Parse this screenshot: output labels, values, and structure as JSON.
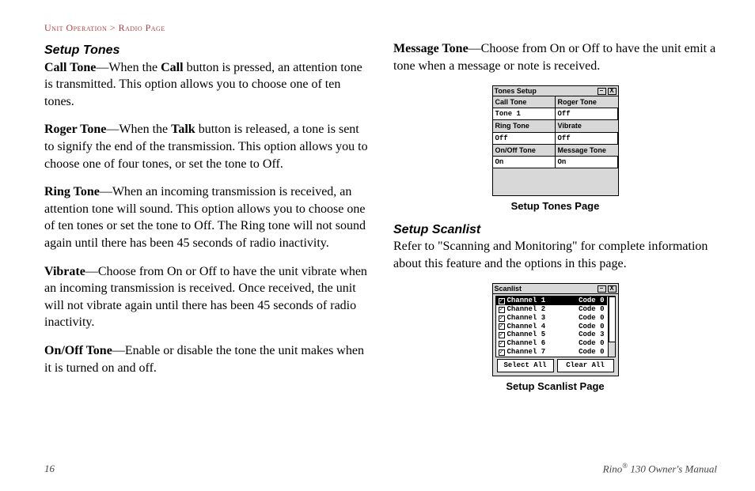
{
  "breadcrumb": "Unit Operation > Radio Page",
  "left": {
    "h1": "Setup Tones",
    "p1_b1": "Call Tone",
    "p1_mid": "—When the ",
    "p1_b2": "Call",
    "p1_rest": " button is pressed, an attention tone is transmitted. This option allows you to choose one of ten tones.",
    "p2_b1": "Roger Tone",
    "p2_mid": "—When the ",
    "p2_b2": "Talk",
    "p2_rest": " button is released, a tone is sent to signify the end of the transmission. This option allows you to choose one of four tones, or set the tone to Off.",
    "p3_b1": "Ring Tone",
    "p3_rest": "—When an incoming transmission is received, an attention tone will sound. This option allows you to choose one of ten tones or set the tone to Off. The Ring tone will not sound again until there has been 45 seconds of radio inactivity.",
    "p4_b1": "Vibrate",
    "p4_rest": "—Choose from On or Off to have the unit vibrate when an incoming transmission is received. Once received, the unit will not vibrate again until there has been 45 seconds of radio inactivity.",
    "p5_b1": "On/Off Tone",
    "p5_rest": "—Enable or disable the tone the unit makes when it is turned on and off."
  },
  "right": {
    "p1_b1": "Message Tone",
    "p1_rest": "—Choose from On or Off to have the unit emit a tone when a message or note is received.",
    "tones_caption": "Setup Tones Page",
    "h2": "Setup Scanlist",
    "p2": "Refer to \"Scanning and Monitoring\" for complete information about this feature and the options in this page.",
    "scan_caption": "Setup Scanlist Page"
  },
  "tones_fig": {
    "title": "Tones Setup",
    "rows": [
      {
        "l_label": "Call Tone",
        "r_label": "Roger Tone",
        "l_val": "Tone 1",
        "r_val": "Off"
      },
      {
        "l_label": "Ring Tone",
        "r_label": "Vibrate",
        "l_val": "Off",
        "r_val": "Off"
      },
      {
        "l_label": "On/Off Tone",
        "r_label": "Message Tone",
        "l_val": "On",
        "r_val": "On"
      }
    ]
  },
  "scan_fig": {
    "title": "Scanlist",
    "items": [
      {
        "label": "Channel 1",
        "code": "Code 0",
        "sel": true
      },
      {
        "label": "Channel 2",
        "code": "Code 0",
        "sel": false
      },
      {
        "label": "Channel 3",
        "code": "Code 0",
        "sel": false
      },
      {
        "label": "Channel 4",
        "code": "Code 0",
        "sel": false
      },
      {
        "label": "Channel 5",
        "code": "Code 3",
        "sel": false
      },
      {
        "label": "Channel 6",
        "code": "Code 0",
        "sel": false
      },
      {
        "label": "Channel 7",
        "code": "Code 0",
        "sel": false
      }
    ],
    "btn_select": "Select All",
    "btn_clear": "Clear All"
  },
  "footer": {
    "page": "16",
    "product_a": "Rino",
    "product_reg": "®",
    "product_b": " 130 Owner's Manual"
  },
  "icons": {
    "min": "–",
    "close": "X",
    "check": "✓"
  }
}
